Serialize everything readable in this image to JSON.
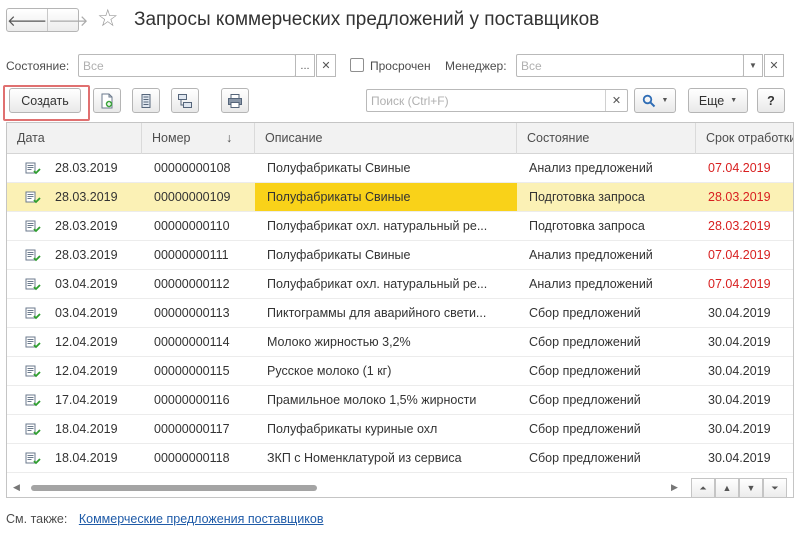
{
  "header": {
    "title": "Запросы коммерческих предложений у поставщиков",
    "back_icon": "arrow-left-icon",
    "forward_icon": "arrow-right-icon",
    "favorite_icon": "star-icon"
  },
  "filters": {
    "status_label": "Состояние:",
    "status_placeholder": "Все",
    "status_choose": "...",
    "overdue_label": "Просрочен",
    "overdue_checked": false,
    "manager_label": "Менеджер:",
    "manager_placeholder": "Все"
  },
  "toolbar": {
    "create_label": "Создать",
    "search_placeholder": "Поиск (Ctrl+F)",
    "more_label": "Еще",
    "help_label": "?"
  },
  "table": {
    "columns": [
      "Дата",
      "Номер",
      "Описание",
      "Состояние",
      "Срок отработки"
    ],
    "sort_indicator": "↓",
    "rows": [
      {
        "date": "28.03.2019",
        "number": "00000000108",
        "description": "Полуфабрикаты Свиные",
        "status": "Анализ предложений",
        "deadline": "07.04.2019",
        "overdue": true,
        "selected": false
      },
      {
        "date": "28.03.2019",
        "number": "00000000109",
        "description": "Полуфабрикаты Свиные",
        "status": "Подготовка запроса",
        "deadline": "28.03.2019",
        "overdue": true,
        "selected": true
      },
      {
        "date": "28.03.2019",
        "number": "00000000110",
        "description": "Полуфабрикат охл. натуральный ре...",
        "status": "Подготовка запроса",
        "deadline": "28.03.2019",
        "overdue": true,
        "selected": false
      },
      {
        "date": "28.03.2019",
        "number": "00000000111",
        "description": "Полуфабрикаты Свиные",
        "status": "Анализ предложений",
        "deadline": "07.04.2019",
        "overdue": true,
        "selected": false
      },
      {
        "date": "03.04.2019",
        "number": "00000000112",
        "description": "Полуфабрикат охл. натуральный ре...",
        "status": "Анализ предложений",
        "deadline": "07.04.2019",
        "overdue": true,
        "selected": false
      },
      {
        "date": "03.04.2019",
        "number": "00000000113",
        "description": "Пиктограммы для аварийного свети...",
        "status": "Сбор предложений",
        "deadline": "30.04.2019",
        "overdue": false,
        "selected": false
      },
      {
        "date": "12.04.2019",
        "number": "00000000114",
        "description": "Молоко жирностью 3,2%",
        "status": "Сбор предложений",
        "deadline": "30.04.2019",
        "overdue": false,
        "selected": false
      },
      {
        "date": "12.04.2019",
        "number": "00000000115",
        "description": "Русское молоко (1 кг)",
        "status": "Сбор предложений",
        "deadline": "30.04.2019",
        "overdue": false,
        "selected": false
      },
      {
        "date": "17.04.2019",
        "number": "00000000116",
        "description": "Прамильное молоко 1,5% жирности",
        "status": "Сбор предложений",
        "deadline": "30.04.2019",
        "overdue": false,
        "selected": false
      },
      {
        "date": "18.04.2019",
        "number": "00000000117",
        "description": "Полуфабрикаты куриные охл",
        "status": "Сбор предложений",
        "deadline": "30.04.2019",
        "overdue": false,
        "selected": false
      },
      {
        "date": "18.04.2019",
        "number": "00000000118",
        "description": "ЗКП с Номенклатурой из сервиса",
        "status": "Сбор предложений",
        "deadline": "30.04.2019",
        "overdue": false,
        "selected": false
      }
    ]
  },
  "colors": {
    "selected_row": "#fbf1b5",
    "focused_cell": "#f9d219",
    "overdue_text": "#d82020",
    "link": "#1f5ba8",
    "highlight_frame": "#e07070"
  },
  "footer": {
    "see_also": "См. также:",
    "link": "Коммерческие предложения поставщиков"
  }
}
